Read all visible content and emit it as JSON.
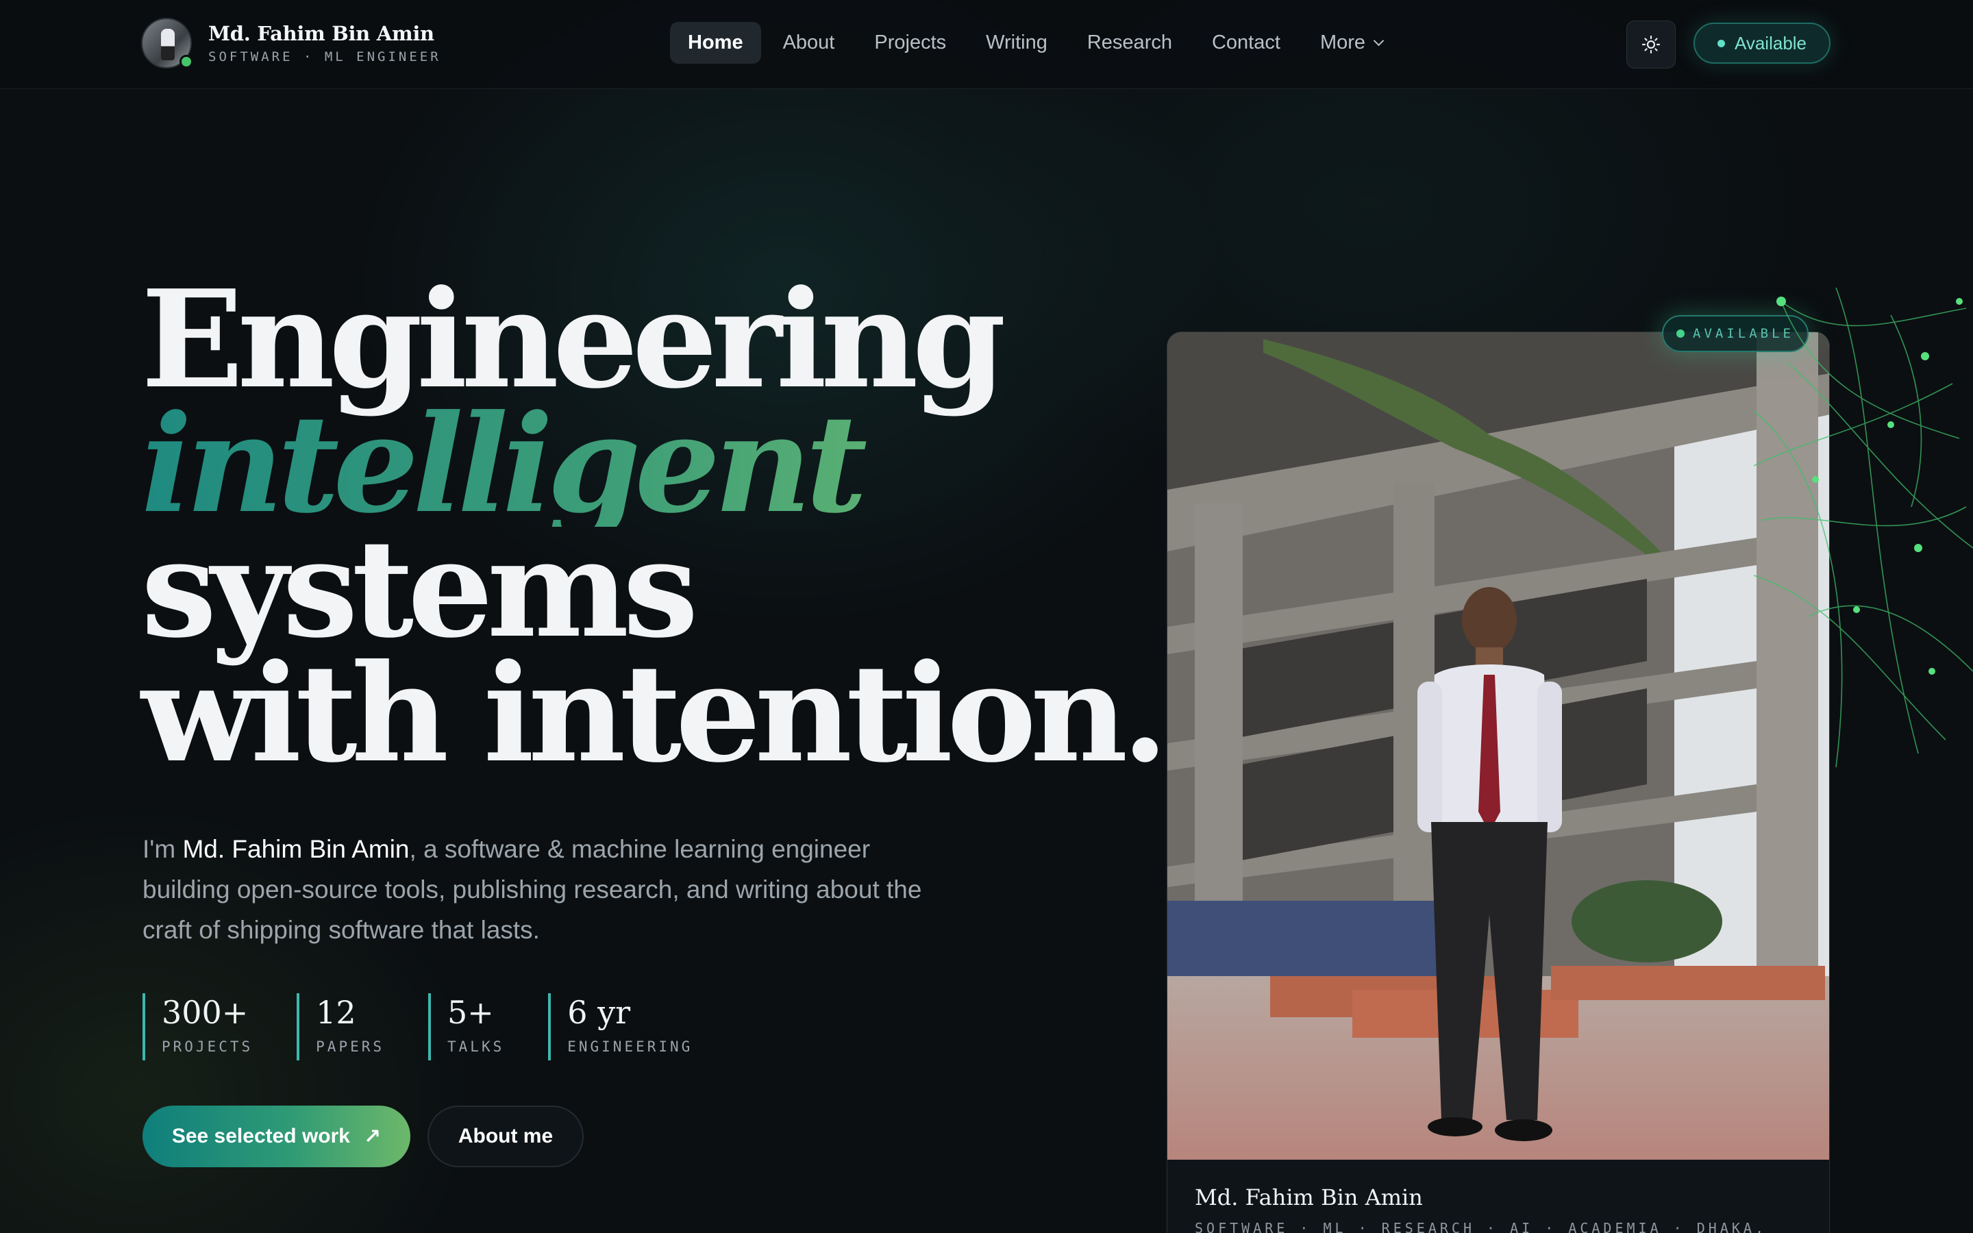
{
  "brand": {
    "name": "Md. Fahim Bin Amin",
    "subtitle": "SOFTWARE · ML ENGINEER"
  },
  "nav": {
    "items": [
      {
        "label": "Home",
        "active": true
      },
      {
        "label": "About"
      },
      {
        "label": "Projects"
      },
      {
        "label": "Writing"
      },
      {
        "label": "Research"
      },
      {
        "label": "Contact"
      },
      {
        "label": "More"
      }
    ],
    "theme_icon": "sun-icon",
    "status_label": "Available"
  },
  "hero": {
    "line1": "Engineering",
    "line2": "intelligent",
    "line3": "systems",
    "line4": "with intention.",
    "intro_prefix": "I'm ",
    "intro_name": "Md. Fahim Bin Amin",
    "intro_rest": ", a software & machine learning engineer building open-source tools, publishing research, and writing about the craft of shipping software that lasts.",
    "stats": [
      {
        "value": "300+",
        "label": "PROJECTS"
      },
      {
        "value": "12",
        "label": "PAPERS"
      },
      {
        "value": "5+",
        "label": "TALKS"
      },
      {
        "value": "6 yr",
        "label": "ENGINEERING"
      }
    ],
    "cta_primary": "See selected work",
    "cta_primary_icon": "arrow-up-right-icon",
    "cta_secondary": "About me"
  },
  "profile_card": {
    "badge": "AVAILABLE",
    "name": "Md. Fahim Bin Amin",
    "tags": "SOFTWARE · ML · RESEARCH · AI · ACADEMIA · DHAKA,"
  },
  "colors": {
    "accent_teal": "#1f8a80",
    "accent_green": "#7bc46e",
    "background": "#0b0f12"
  }
}
